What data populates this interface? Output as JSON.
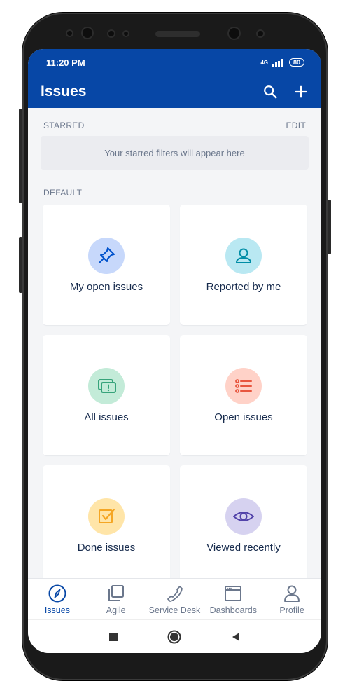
{
  "status": {
    "time": "11:20 PM",
    "network": "4G",
    "battery": "80"
  },
  "appbar": {
    "title": "Issues",
    "search_icon": "search-icon",
    "add_icon": "plus-icon"
  },
  "starred": {
    "heading": "STARRED",
    "edit": "EDIT",
    "empty_text": "Your starred filters will appear here"
  },
  "default": {
    "heading": "DEFAULT",
    "cards": [
      {
        "label": "My open issues",
        "icon": "pin-icon",
        "bg": "#c7d8fb",
        "color": "#0052cc"
      },
      {
        "label": "Reported by me",
        "icon": "user-icon",
        "bg": "#b9e8f2",
        "color": "#008da6"
      },
      {
        "label": "All issues",
        "icon": "issues-stack-icon",
        "bg": "#c3ebd8",
        "color": "#36a37a"
      },
      {
        "label": "Open issues",
        "icon": "list-icon",
        "bg": "#ffd2c8",
        "color": "#e8563f"
      },
      {
        "label": "Done issues",
        "icon": "checkbox-icon",
        "bg": "#ffe5a8",
        "color": "#f5a623"
      },
      {
        "label": "Viewed recently",
        "icon": "eye-icon",
        "bg": "#d6d2f0",
        "color": "#5243aa"
      }
    ]
  },
  "bottomnav": [
    {
      "label": "Issues",
      "icon": "compass-icon",
      "active": true
    },
    {
      "label": "Agile",
      "icon": "board-icon",
      "active": false
    },
    {
      "label": "Service Desk",
      "icon": "phone-icon",
      "active": false
    },
    {
      "label": "Dashboards",
      "icon": "dashboard-icon",
      "active": false
    },
    {
      "label": "Profile",
      "icon": "profile-icon",
      "active": false
    }
  ],
  "sysnav": {
    "recents": "square-icon",
    "home": "circle-icon",
    "back": "triangle-back-icon"
  }
}
